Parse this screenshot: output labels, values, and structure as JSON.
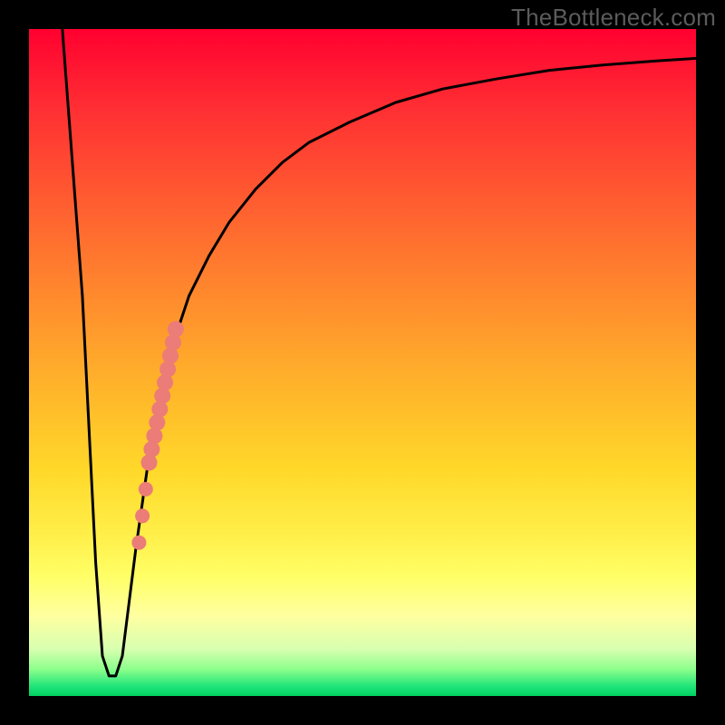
{
  "watermark": "TheBottleneck.com",
  "chart_data": {
    "type": "line",
    "title": "",
    "xlabel": "",
    "ylabel": "",
    "xlim": [
      0,
      100
    ],
    "ylim": [
      0,
      100
    ],
    "grid": false,
    "legend": false,
    "series": [
      {
        "name": "bottleneck-curve",
        "color": "#000000",
        "x": [
          5,
          8,
          10,
          11,
          12,
          13,
          14,
          15,
          16,
          18,
          20,
          22,
          24,
          27,
          30,
          34,
          38,
          42,
          48,
          55,
          62,
          70,
          78,
          86,
          94,
          100
        ],
        "y": [
          100,
          60,
          20,
          6,
          3,
          3,
          6,
          14,
          22,
          36,
          46,
          54,
          60,
          66,
          71,
          76,
          80,
          83,
          86,
          89,
          91,
          92.5,
          93.8,
          94.6,
          95.2,
          95.6
        ]
      }
    ],
    "scatter": {
      "name": "highlighted-points",
      "color": "#eb7c78",
      "points": [
        {
          "x": 22.0,
          "y": 55
        },
        {
          "x": 21.6,
          "y": 53
        },
        {
          "x": 21.2,
          "y": 51
        },
        {
          "x": 20.8,
          "y": 49
        },
        {
          "x": 20.4,
          "y": 47
        },
        {
          "x": 20.0,
          "y": 45
        },
        {
          "x": 19.6,
          "y": 43
        },
        {
          "x": 19.2,
          "y": 41
        },
        {
          "x": 18.8,
          "y": 39
        },
        {
          "x": 18.4,
          "y": 37
        },
        {
          "x": 18.0,
          "y": 35
        },
        {
          "x": 17.5,
          "y": 31
        },
        {
          "x": 17.0,
          "y": 27
        },
        {
          "x": 16.5,
          "y": 23
        }
      ]
    },
    "background_gradient": {
      "top": "#ff0030",
      "mid_upper": "#ffa92b",
      "mid_lower": "#ffff66",
      "bottom": "#00d060"
    }
  }
}
